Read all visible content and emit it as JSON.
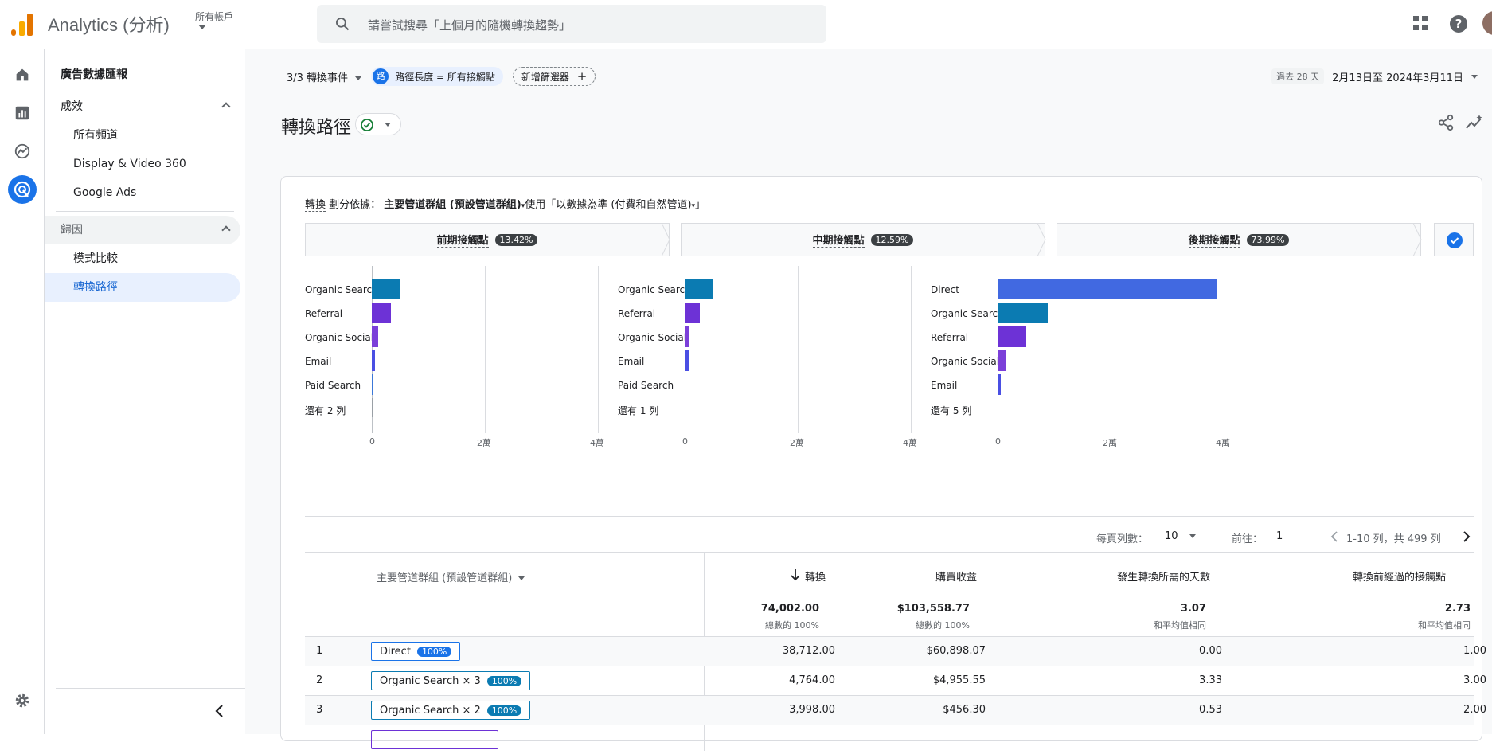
{
  "app": {
    "title": "Analytics (分析)",
    "account": "所有帳戶"
  },
  "search": {
    "placeholder": "請嘗試搜尋「上個月的隨機轉換趨勢」"
  },
  "sidebar": {
    "top_item": "廣告數據匯報",
    "section1": {
      "label": "成效",
      "items": [
        "所有頻道",
        "Display & Video 360",
        "Google Ads"
      ]
    },
    "section2": {
      "label": "歸因",
      "items": [
        "模式比較",
        "轉換路徑"
      ]
    }
  },
  "filters": {
    "events": "3/3 轉換事件",
    "chip_icon": "路",
    "chip_label": "路徑長度 = 所有接觸點",
    "add_filter": "新增篩選器"
  },
  "date": {
    "badge": "過去 28 天",
    "range": "2月13日至 2024年3月11日"
  },
  "page_title": "轉換路徑",
  "card": {
    "header_prefix": "轉換",
    "header_mid": " 劃分依據： ",
    "header_dim": "主要管道群組 (預設管道群組)",
    "header_suffix": "使用「以數據為準 (付費和自然管道)",
    "header_end": "」",
    "stages": [
      {
        "label": "前期接觸點",
        "pct": "13.42%"
      },
      {
        "label": "中期接觸點",
        "pct": "12.59%"
      },
      {
        "label": "後期接觸點",
        "pct": "73.99%"
      }
    ],
    "axis_ticks": [
      "0",
      "2萬",
      "4萬"
    ]
  },
  "chart_data": [
    {
      "type": "bar",
      "title": "前期接觸點",
      "categories": [
        "Organic Search",
        "Referral",
        "Organic Social",
        "Email",
        "Paid Search",
        "還有 2 列"
      ],
      "values": [
        5100,
        3400,
        1100,
        500,
        100,
        50
      ],
      "xlim": [
        0,
        40000
      ],
      "colors": [
        "#0b7bb2",
        "#6d32d6",
        "#7b3fd9",
        "#4a4fe3",
        "#3c78d8",
        "#9aa0a6"
      ]
    },
    {
      "type": "bar",
      "title": "中期接觸點",
      "categories": [
        "Organic Search",
        "Referral",
        "Organic Social",
        "Email",
        "Paid Search",
        "還有 1 列"
      ],
      "values": [
        5000,
        2700,
        900,
        700,
        100,
        50
      ],
      "xlim": [
        0,
        40000
      ],
      "colors": [
        "#0b7bb2",
        "#6d32d6",
        "#7b3fd9",
        "#4a4fe3",
        "#3c78d8",
        "#9aa0a6"
      ]
    },
    {
      "type": "bar",
      "title": "後期接觸點",
      "categories": [
        "Direct",
        "Organic Search",
        "Referral",
        "Organic Social",
        "Email",
        "還有 5 列"
      ],
      "values": [
        38712,
        8900,
        5000,
        1400,
        550,
        50
      ],
      "xlim": [
        0,
        40000
      ],
      "colors": [
        "#4169e1",
        "#0b7bb2",
        "#6d32d6",
        "#7b3fd9",
        "#4a4fe3",
        "#9aa0a6"
      ]
    }
  ],
  "pager": {
    "rows_label": "每頁列數：",
    "rows_value": "10",
    "goto_label": "前往：",
    "goto_value": "1",
    "range": "1-10 列，共 499 列"
  },
  "table": {
    "dim_header": "主要管道群組 (預設管道群組)",
    "columns": [
      "轉換",
      "購買收益",
      "發生轉換所需的天數",
      "轉換前經過的接觸點"
    ],
    "totals": [
      "74,002.00",
      "$103,558.77",
      "3.07",
      "2.73"
    ],
    "totals_sub": [
      "總數的 100%",
      "總數的 100%",
      "和平均值相同",
      "和平均值相同"
    ],
    "rows": [
      {
        "idx": "1",
        "path": "Direct",
        "pct": "100%",
        "vals": [
          "38,712.00",
          "$60,898.07",
          "0.00",
          "1.00"
        ]
      },
      {
        "idx": "2",
        "path": "Organic Search × 3",
        "pct": "100%",
        "vals": [
          "4,764.00",
          "$4,955.55",
          "3.33",
          "3.00"
        ]
      },
      {
        "idx": "3",
        "path": "Organic Search × 2",
        "pct": "100%",
        "vals": [
          "3,998.00",
          "$456.30",
          "0.53",
          "2.00"
        ]
      }
    ]
  }
}
